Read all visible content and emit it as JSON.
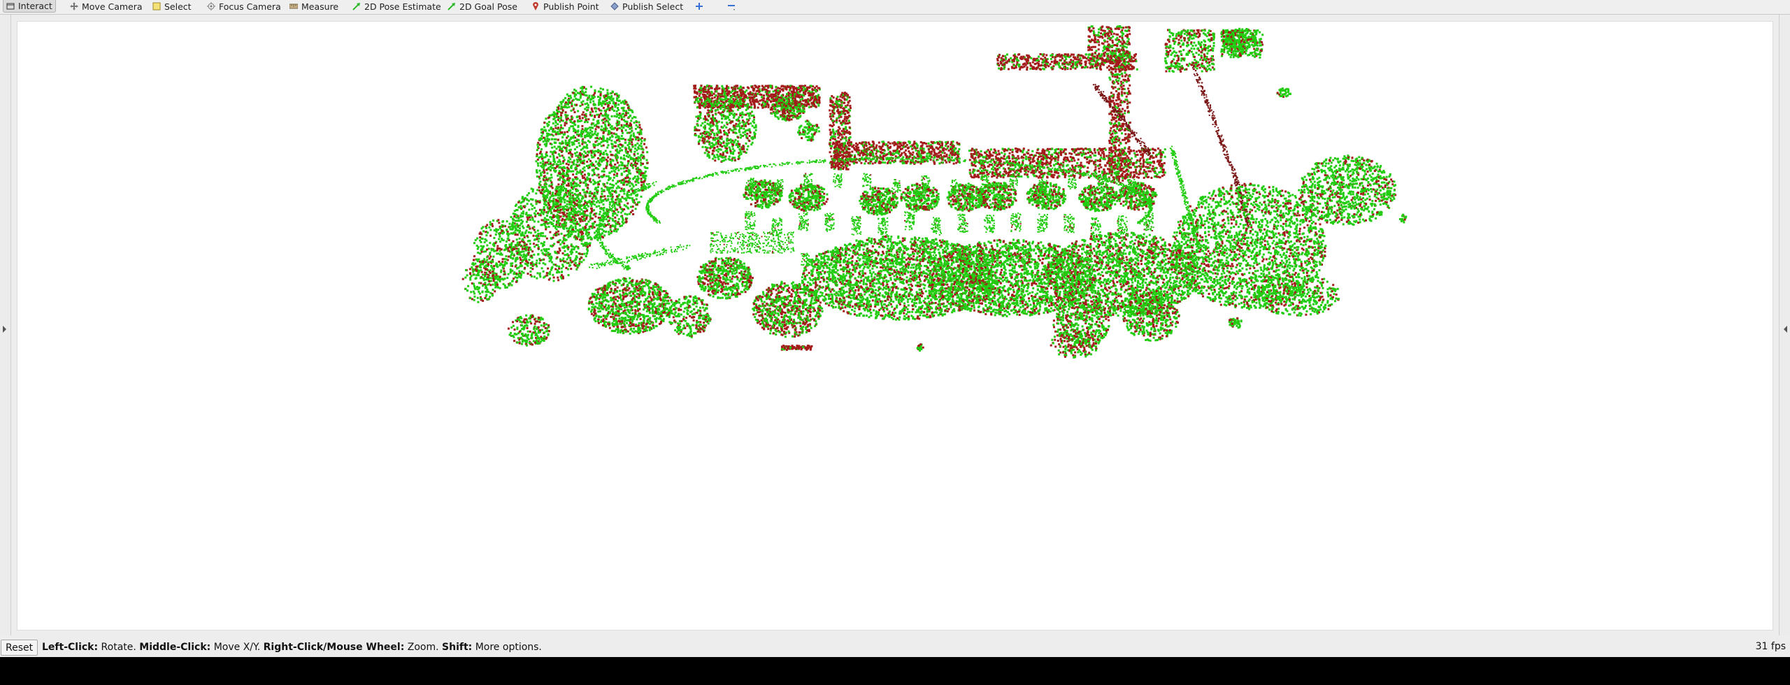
{
  "toolbar": {
    "tools": [
      {
        "label": "Interact",
        "icon": "interact-icon"
      },
      {
        "label": "Move Camera",
        "icon": "move-camera-icon"
      },
      {
        "label": "Select",
        "icon": "select-icon"
      },
      {
        "label": "Focus Camera",
        "icon": "focus-camera-icon"
      },
      {
        "label": "Measure",
        "icon": "measure-icon"
      },
      {
        "label": "2D Pose Estimate",
        "icon": "green-arrow-icon"
      },
      {
        "label": "2D Goal Pose",
        "icon": "green-arrow-icon"
      },
      {
        "label": "Publish Point",
        "icon": "pin-icon"
      },
      {
        "label": "Publish Select",
        "icon": "publish-select-icon"
      }
    ],
    "add_tool_icon": "plus-icon",
    "remove_tool_icon": "minus-icon",
    "active_tool": "Interact"
  },
  "viewport": {
    "background": "#ffffff",
    "colors": {
      "green": "#22cc11",
      "red": "#a41b1b",
      "dark_red": "#7a1515"
    }
  },
  "statusbar": {
    "reset_label": "Reset",
    "help": [
      {
        "key": "Left-Click:",
        "action": " Rotate. "
      },
      {
        "key": "Middle-Click:",
        "action": " Move X/Y. "
      },
      {
        "key": "Right-Click/Mouse Wheel:",
        "action": " Zoom. "
      },
      {
        "key": "Shift:",
        "action": " More options."
      }
    ],
    "fps": "31 fps"
  }
}
